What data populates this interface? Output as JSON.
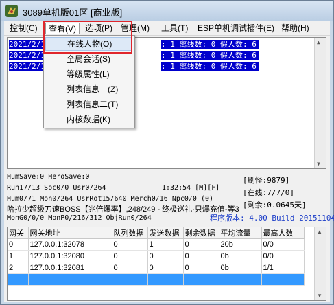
{
  "window": {
    "title": "3089单机版01区 [商业版]",
    "icon": "app-dragon-icon"
  },
  "menubar": [
    {
      "label": "控制(C)"
    },
    {
      "label": "查看(V)"
    },
    {
      "label": "选项(P)"
    },
    {
      "label": "管理(M)"
    },
    {
      "label": "工具(T)"
    },
    {
      "label": "ESP单机调试插件(E)"
    },
    {
      "label": "帮助(H)"
    }
  ],
  "log": {
    "lines": [
      {
        "left": "2021/2/1",
        "right": ": 1 离线数: 0 假人数: 6"
      },
      {
        "left": "2021/2/1",
        "right": ": 1 离线数: 0 假人数: 6"
      },
      {
        "left": "2021/2/1",
        "right": ": 1 离线数: 0 假人数: 6"
      }
    ]
  },
  "dropdown": [
    {
      "label": "在线人物(O)"
    },
    {
      "label": "全局会话(S)"
    },
    {
      "label": "等级属性(L)"
    },
    {
      "label": "列表信息一(Z)"
    },
    {
      "label": "列表信息二(T)"
    },
    {
      "label": "内核数据(K)"
    }
  ],
  "status": {
    "line1": "HumSave:0 HeroSave:0",
    "line2": "Run17/13 Soc0/0 Usr0/264",
    "clock": "1:32:54 [M][F]",
    "brush": "[刷怪:9879]",
    "online": "[在线:7/7/0]",
    "line3": "Hum0/71 Mon0/264 UsrRot15/640 Merch0/16 Npc0/0 (0)",
    "broadcast": "哈拉少超级刀速BOSS【兆倍爆率】,248/249 - 终极巡礼·只爆充值-等3",
    "days": "[剩余:0.0645天]",
    "line4": "MonG0/0/0 MonP0/216/312 ObjRun0/264",
    "version": "程序版本: 4.00 Build 20151104"
  },
  "table": {
    "columns": [
      "网关",
      "网关地址",
      "队列数据",
      "发送数据",
      "剩余数据",
      "平均流量",
      "最高人数"
    ],
    "rows": [
      [
        "0",
        "127.0.0.1:32078",
        "0",
        "1",
        "0",
        "20b",
        "0/0"
      ],
      [
        "1",
        "127.0.0.1:32080",
        "0",
        "0",
        "0",
        "0b",
        "0/0"
      ],
      [
        "2",
        "127.0.0.1:32081",
        "0",
        "0",
        "0",
        "0b",
        "1/1"
      ],
      [
        "",
        "",
        "",
        "",
        "",
        "",
        ""
      ]
    ]
  },
  "colors": {
    "highlight": "#0000cc",
    "selected_row": "#3399ff",
    "annotation": "#e0262c",
    "version_text": "#1a3cc8"
  }
}
